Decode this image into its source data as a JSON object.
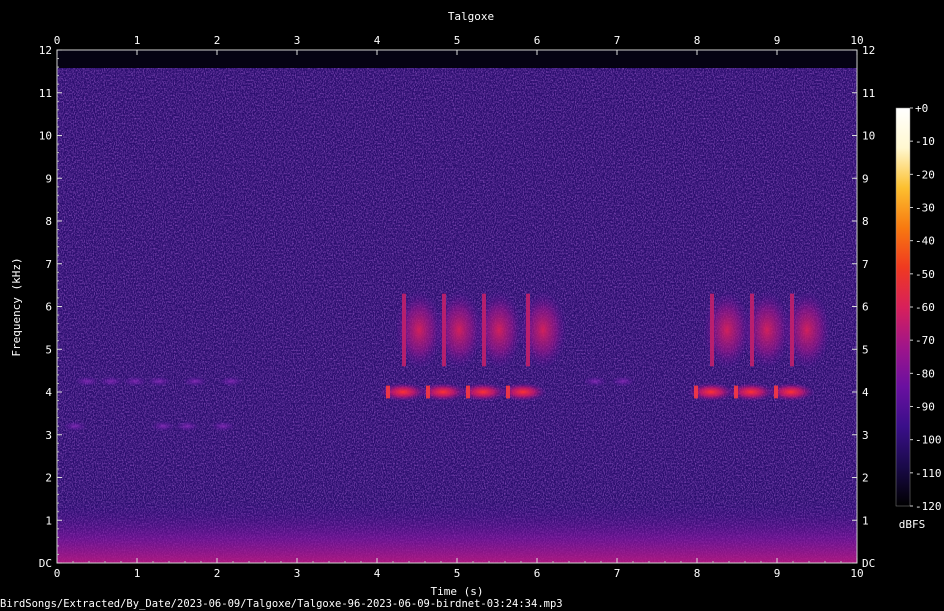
{
  "chart_data": {
    "type": "heatmap",
    "title": "Talgoxe",
    "xlabel": "Time (s)",
    "ylabel": "Frequency (kHz)",
    "xlim": [
      0,
      10
    ],
    "ylim": [
      0,
      12
    ],
    "x_ticks": [
      "0",
      "1",
      "2",
      "3",
      "4",
      "5",
      "6",
      "7",
      "8",
      "9",
      "10"
    ],
    "y_ticks": [
      "DC",
      "1",
      "2",
      "3",
      "4",
      "5",
      "6",
      "7",
      "8",
      "9",
      "10",
      "11",
      "12"
    ],
    "colorbar": {
      "label": "dBFS",
      "range": [
        -120,
        0
      ],
      "ticks": [
        "+0",
        "-10",
        "-20",
        "-30",
        "-40",
        "-50",
        "-60",
        "-70",
        "-80",
        "-90",
        "-100",
        "-110",
        "-120"
      ],
      "colors": [
        "#000000",
        "#1a0a4a",
        "#3a0f8a",
        "#6a10a0",
        "#a0158a",
        "#d8205a",
        "#f03a20",
        "#f87a10",
        "#fcc030",
        "#fff8d0",
        "#ffffff"
      ]
    },
    "calls": [
      {
        "t": 4.15,
        "f_low": 3.85,
        "f_high": 4.15,
        "level_db": -50
      },
      {
        "t": 4.35,
        "f_low": 4.6,
        "f_high": 6.3,
        "level_db": -55
      },
      {
        "t": 4.65,
        "f_low": 3.85,
        "f_high": 4.15,
        "level_db": -50
      },
      {
        "t": 4.85,
        "f_low": 4.6,
        "f_high": 6.3,
        "level_db": -55
      },
      {
        "t": 5.15,
        "f_low": 3.85,
        "f_high": 4.15,
        "level_db": -50
      },
      {
        "t": 5.35,
        "f_low": 4.6,
        "f_high": 6.3,
        "level_db": -55
      },
      {
        "t": 5.65,
        "f_low": 3.85,
        "f_high": 4.15,
        "level_db": -50
      },
      {
        "t": 5.9,
        "f_low": 4.6,
        "f_high": 6.3,
        "level_db": -55
      },
      {
        "t": 8.0,
        "f_low": 3.85,
        "f_high": 4.15,
        "level_db": -50
      },
      {
        "t": 8.2,
        "f_low": 4.6,
        "f_high": 6.3,
        "level_db": -55
      },
      {
        "t": 8.5,
        "f_low": 3.85,
        "f_high": 4.15,
        "level_db": -50
      },
      {
        "t": 8.7,
        "f_low": 4.6,
        "f_high": 6.3,
        "level_db": -55
      },
      {
        "t": 9.0,
        "f_low": 3.85,
        "f_high": 4.15,
        "level_db": -50
      },
      {
        "t": 9.2,
        "f_low": 4.6,
        "f_high": 6.3,
        "level_db": -55
      }
    ],
    "faint_calls": [
      {
        "t": 0.3,
        "f": 4.25
      },
      {
        "t": 0.6,
        "f": 4.25
      },
      {
        "t": 0.9,
        "f": 4.25
      },
      {
        "t": 1.2,
        "f": 4.25
      },
      {
        "t": 1.65,
        "f": 4.25
      },
      {
        "t": 2.1,
        "f": 4.25
      },
      {
        "t": 0.15,
        "f": 3.2
      },
      {
        "t": 1.25,
        "f": 3.2
      },
      {
        "t": 1.55,
        "f": 3.2
      },
      {
        "t": 2.0,
        "f": 3.2
      },
      {
        "t": 6.65,
        "f": 4.25
      },
      {
        "t": 7.0,
        "f": 4.25
      }
    ]
  },
  "footer": {
    "file_path": "BirdSongs/Extracted/By_Date/2023-06-09/Talgoxe/Talgoxe-96-2023-06-09-birdnet-03:24:34.mp3"
  }
}
